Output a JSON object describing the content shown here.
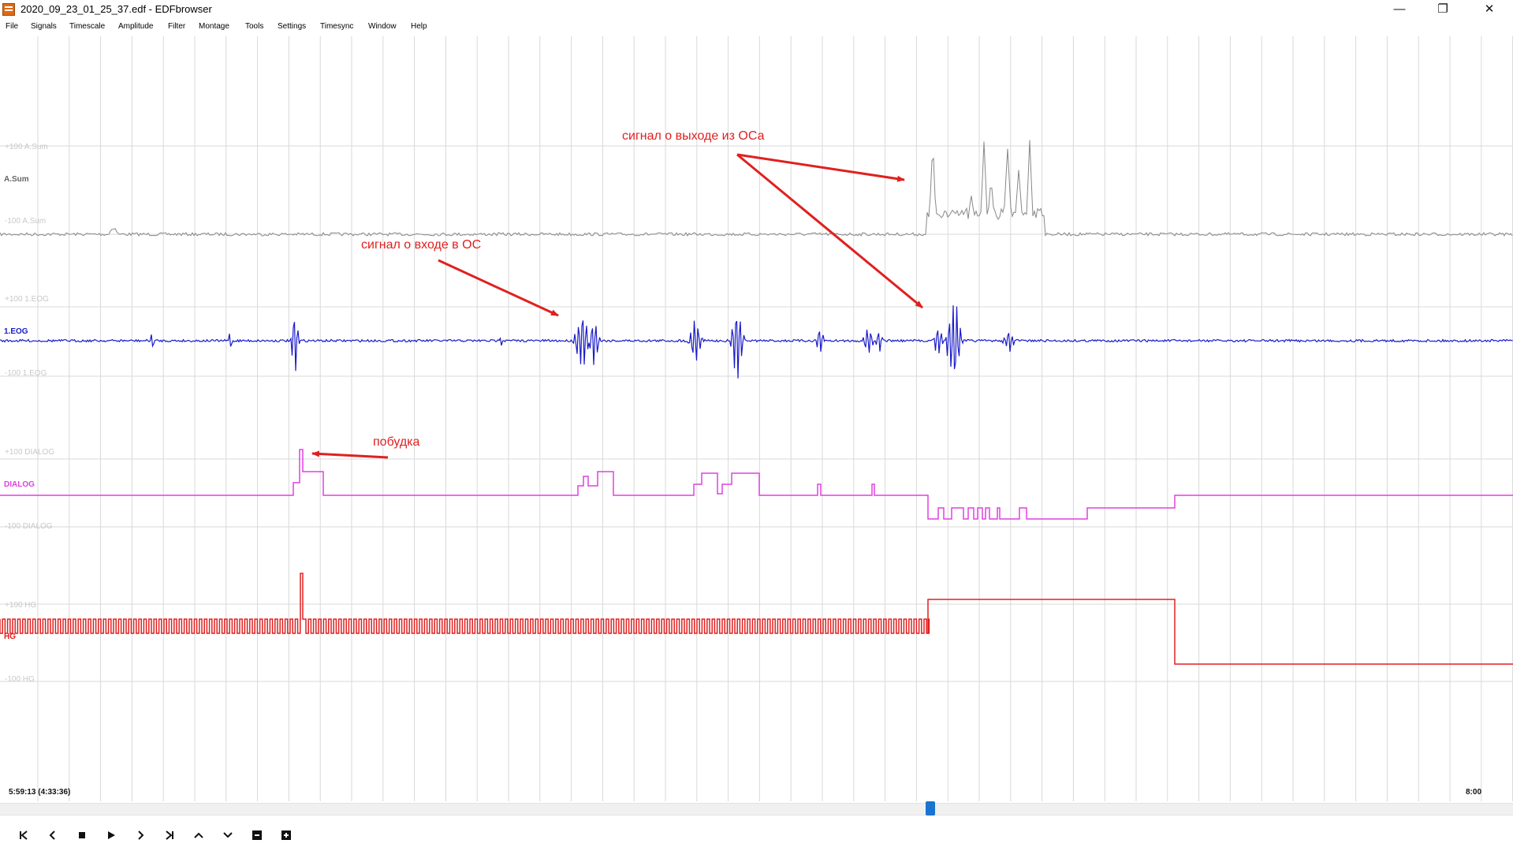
{
  "window": {
    "title": "2020_09_23_01_25_37.edf - EDFbrowser",
    "icon": "edf-app-icon",
    "controls": {
      "minimize": "—",
      "maximize": "❐",
      "close": "✕"
    }
  },
  "menu": [
    "File",
    "Signals",
    "Timescale",
    "Amplitude",
    "Filter",
    "Montage",
    "Tools",
    "Settings",
    "Timesync",
    "Window",
    "Help"
  ],
  "signals": [
    {
      "name": "A.Sum",
      "upper": "+100 A.Sum",
      "lower": "-100 A.Sum",
      "color": "#888888"
    },
    {
      "name": "1.EOG",
      "upper": "+100 1.EOG",
      "lower": "-100 1.EOG",
      "color": "#1a1ac8"
    },
    {
      "name": "DIALOG",
      "upper": "+100 DIALOG",
      "lower": "-100 DIALOG",
      "color": "#e040e0"
    },
    {
      "name": "HG",
      "upper": "+100 HG",
      "lower": "-100 HG",
      "color": "#e02020"
    }
  ],
  "annotations": {
    "exit": "сигнал о выходе из ОСа",
    "entry": "сигнал о входе в ОС",
    "wake": "побудка",
    "color": "#e02020"
  },
  "timeline": {
    "start": "5:59:13 (4:33:36)",
    "end": "8:00"
  },
  "scrollbar": {
    "position": 0.615,
    "thumb_color": "#1874d0"
  },
  "toolbar": {
    "buttons": [
      {
        "name": "first",
        "glyph": "|<"
      },
      {
        "name": "prev",
        "glyph": "<"
      },
      {
        "name": "stop",
        "glyph": "■"
      },
      {
        "name": "play",
        "glyph": "▶"
      },
      {
        "name": "next",
        "glyph": ">"
      },
      {
        "name": "last",
        "glyph": ">|"
      },
      {
        "name": "up",
        "glyph": "^"
      },
      {
        "name": "down",
        "glyph": "v"
      },
      {
        "name": "zoom-out",
        "glyph": "−"
      },
      {
        "name": "zoom-in",
        "glyph": "+"
      }
    ]
  }
}
